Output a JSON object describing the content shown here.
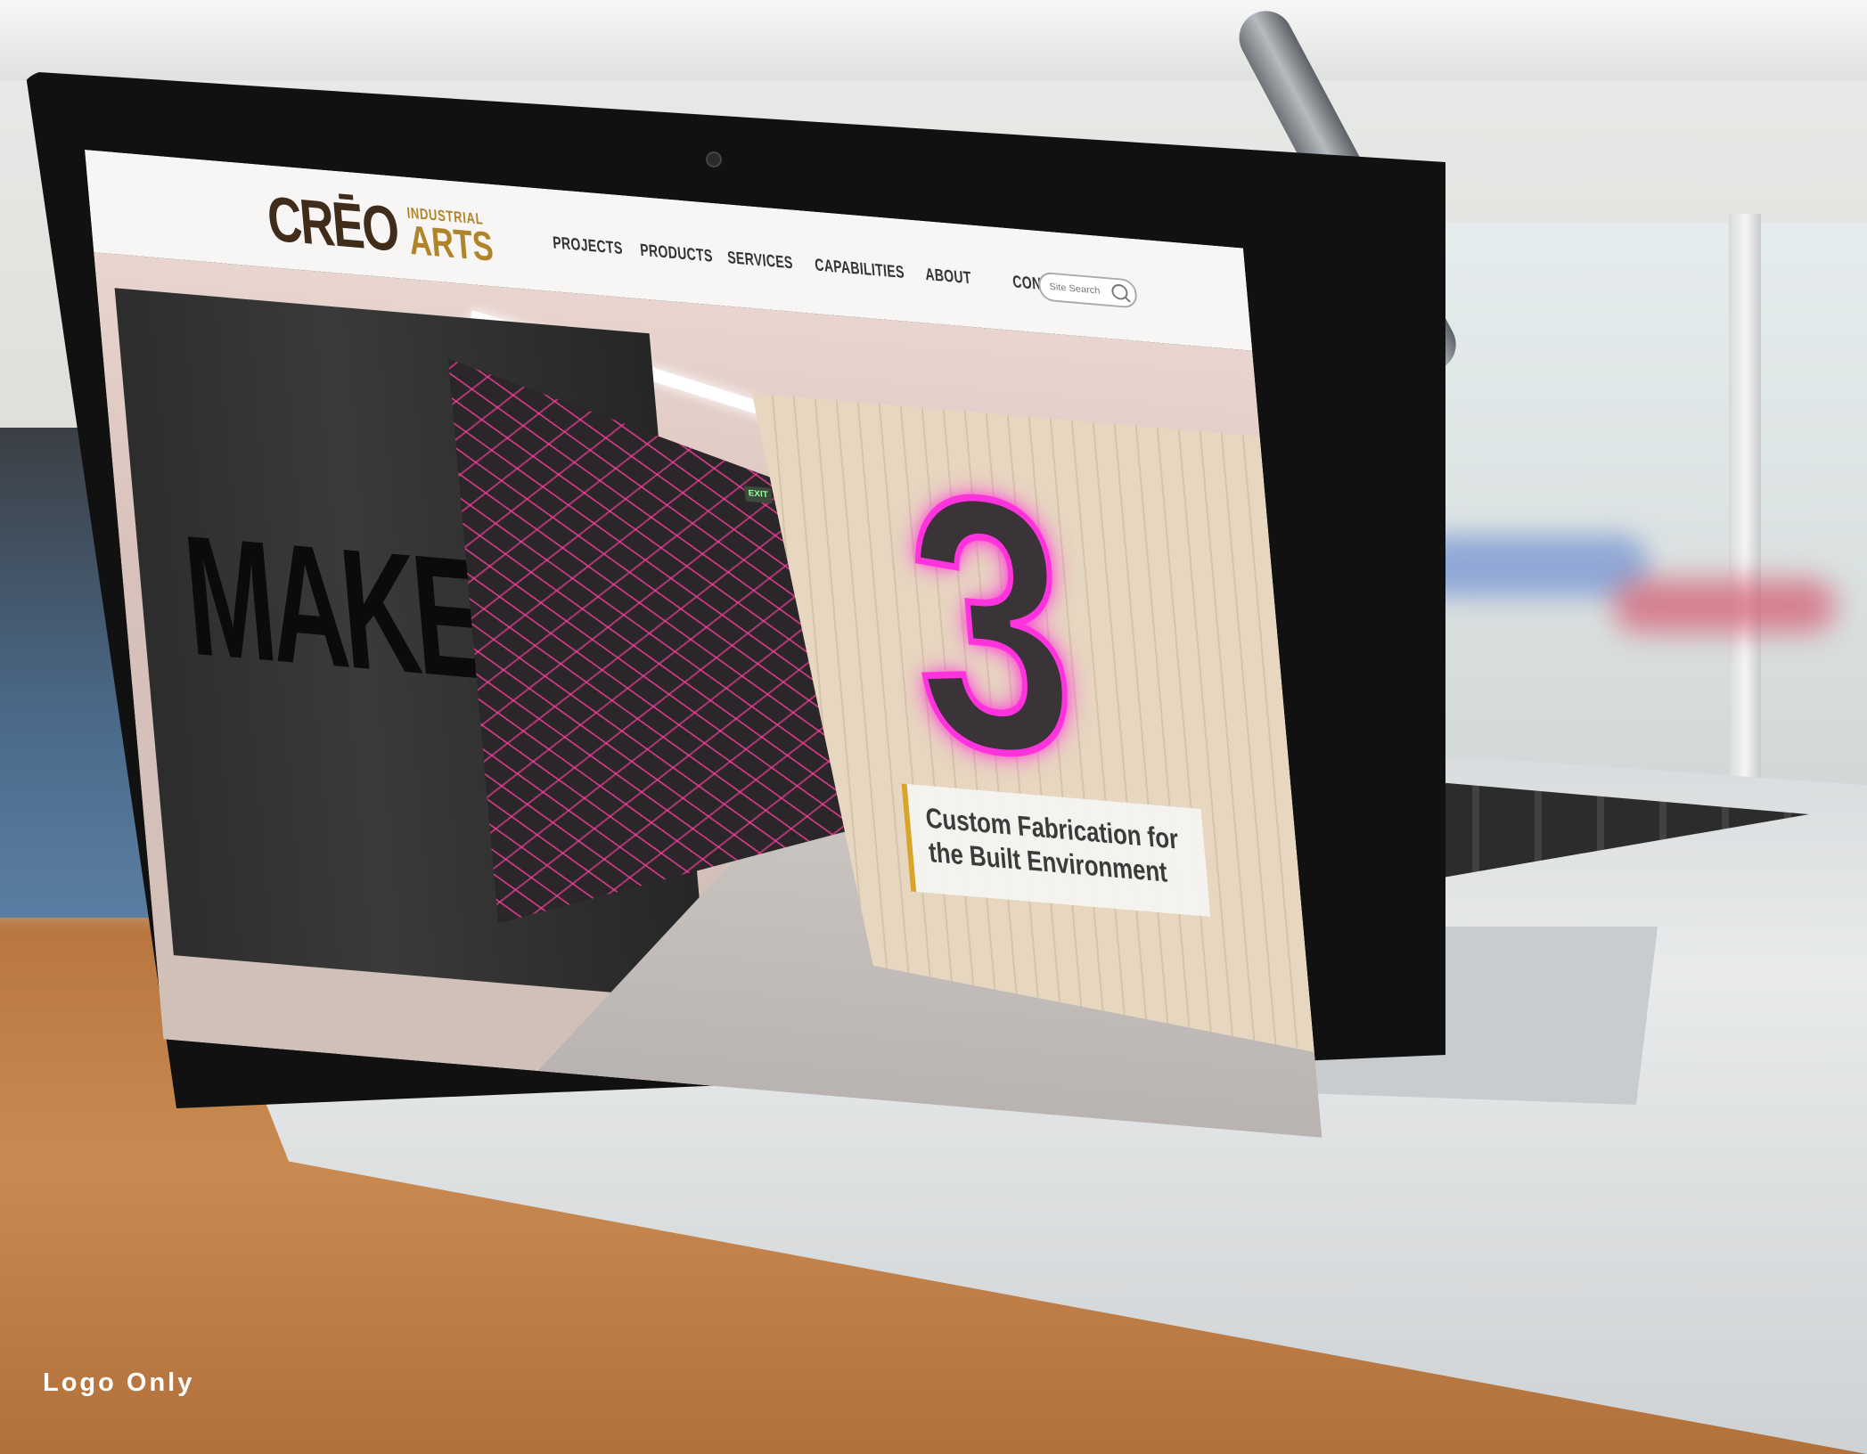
{
  "site": {
    "logo": {
      "main": "CRĒO",
      "sub_top": "INDUSTRIAL",
      "sub_bottom": "ARTS"
    },
    "nav": [
      {
        "label": "PROJECTS"
      },
      {
        "label": "PRODUCTS"
      },
      {
        "label": "SERVICES"
      },
      {
        "label": "CAPABILITIES"
      },
      {
        "label": "ABOUT"
      },
      {
        "label": "CONTACT US"
      }
    ],
    "search": {
      "placeholder": "Site Search",
      "icon": "search-icon"
    }
  },
  "hero": {
    "wall_text": "MAKE",
    "numeral": "3",
    "exit_sign": "EXIT",
    "tagline": {
      "line1": "Custom Fabrication for",
      "line2": "the Built Environment"
    },
    "accent_color": "#d8a52a",
    "neon_color": "#ff33dd",
    "string_art_color": "#ff4aa3"
  },
  "watermark": "Logo Only"
}
